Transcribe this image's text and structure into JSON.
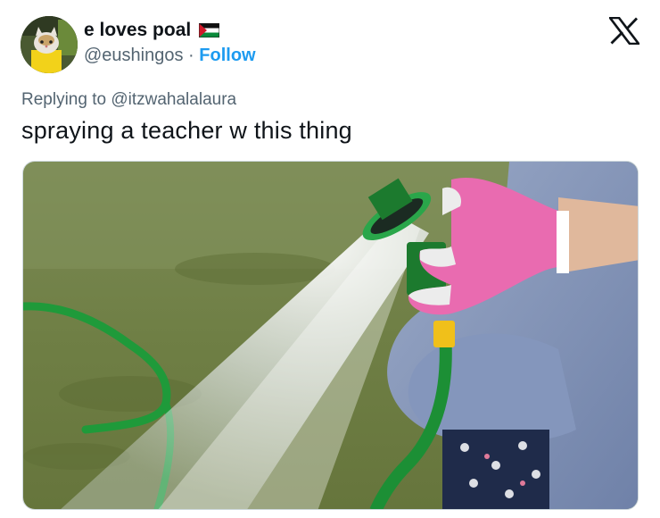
{
  "tweet": {
    "author": {
      "display_name": "e loves poal",
      "handle": "@eushingos",
      "separator": " · ",
      "follow_label": "Follow",
      "flag_icon": "palestine-flag-icon",
      "avatar_icon": "cat-avatar"
    },
    "reply_prefix": "Replying to ",
    "reply_handle": "@itzwahalalaura",
    "text": "spraying a teacher w this thing",
    "platform_icon": "x-logo-icon",
    "media": {
      "description_icon": "hose-spray-photo"
    }
  },
  "colors": {
    "link_blue": "#1d9bf0",
    "secondary_text": "#536471",
    "primary_text": "#0f1419"
  }
}
